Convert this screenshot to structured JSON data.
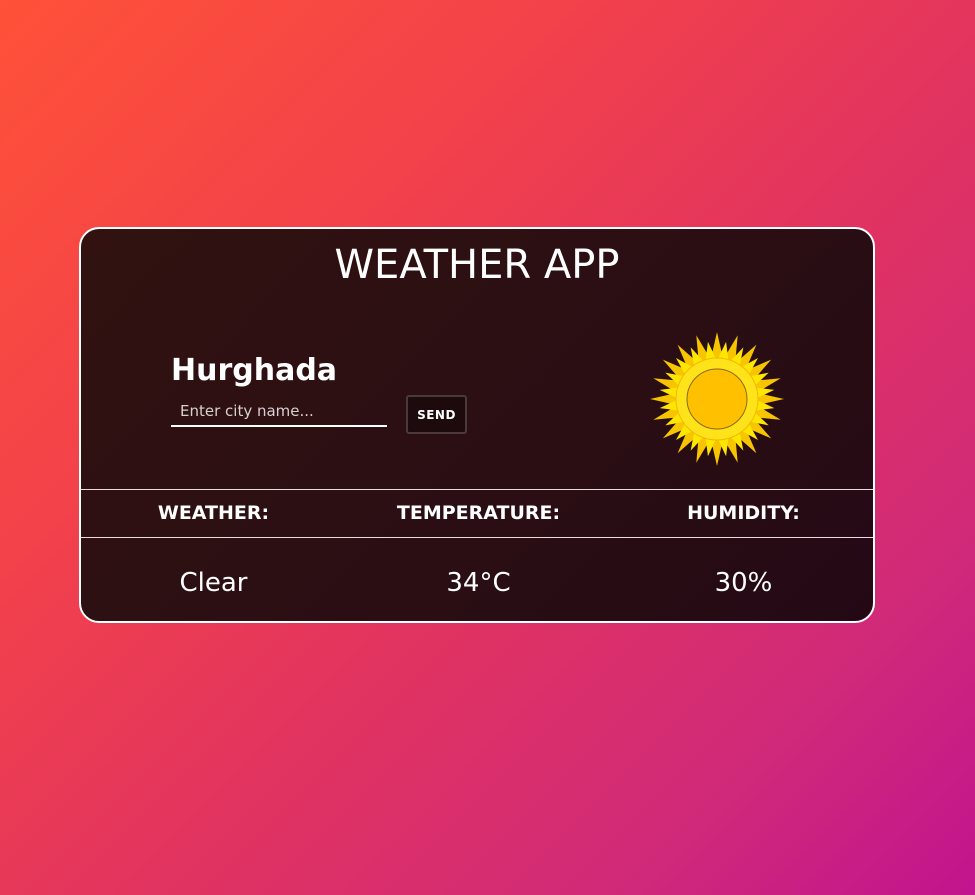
{
  "app": {
    "title": "WEATHER APP"
  },
  "location": {
    "city": "Hurghada"
  },
  "search": {
    "value": "",
    "placeholder": "Enter city name...",
    "send_label": "SEND"
  },
  "weather_icon": "sun-icon",
  "columns": [
    {
      "header": "WEATHER:",
      "value": "Clear"
    },
    {
      "header": "TEMPERATURE:",
      "value": "34°C"
    },
    {
      "header": "HUMIDITY:",
      "value": "30%"
    }
  ],
  "colors": {
    "background_start": "#ff5138",
    "background_end": "#c2148e",
    "card_background": "#2c0f13",
    "card_border": "#ffffff",
    "text": "#ffffff",
    "sun_rays": "#ffd400",
    "sun_core": "#ffc000"
  }
}
